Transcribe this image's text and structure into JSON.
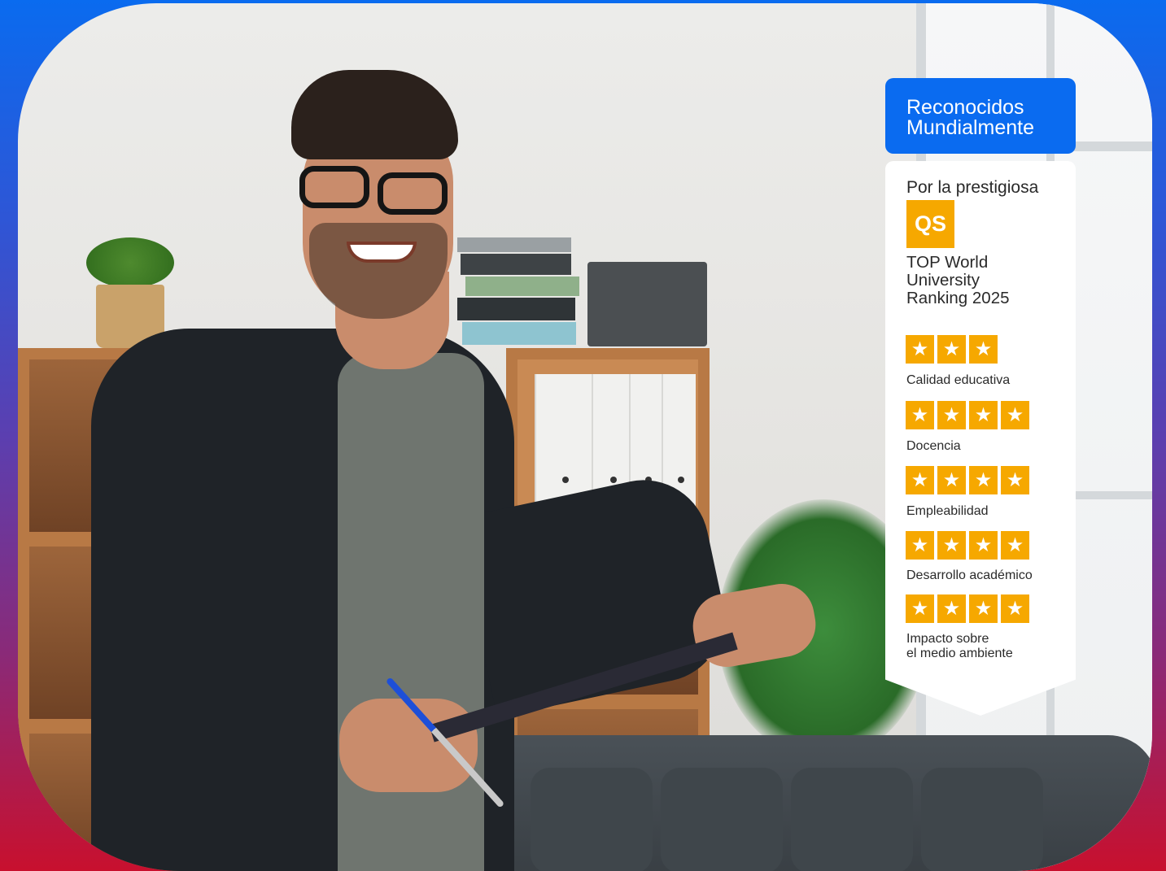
{
  "badge": {
    "title_line1": "Reconocidos",
    "title_line2": "Mundialmente",
    "subtitle": "Por la prestigiosa",
    "logo_text": "QS",
    "ranking_line1": "TOP World",
    "ranking_line2": "University",
    "ranking_line3": "Ranking 2025",
    "star_glyph": "★",
    "categories": [
      {
        "label_line1": "Calidad educativa",
        "label_line2": "",
        "stars": 3
      },
      {
        "label_line1": "Docencia",
        "label_line2": "",
        "stars": 4
      },
      {
        "label_line1": "Empleabilidad",
        "label_line2": "",
        "stars": 4
      },
      {
        "label_line1": "Desarrollo académico",
        "label_line2": "",
        "stars": 4
      },
      {
        "label_line1": "Impacto sobre",
        "label_line2": "el medio ambiente",
        "stars": 4
      }
    ]
  },
  "colors": {
    "header_blue": "#0a6bf0",
    "star_gold": "#f6a800",
    "gradient_top": "#0a6bef",
    "gradient_bottom": "#c8102e"
  }
}
